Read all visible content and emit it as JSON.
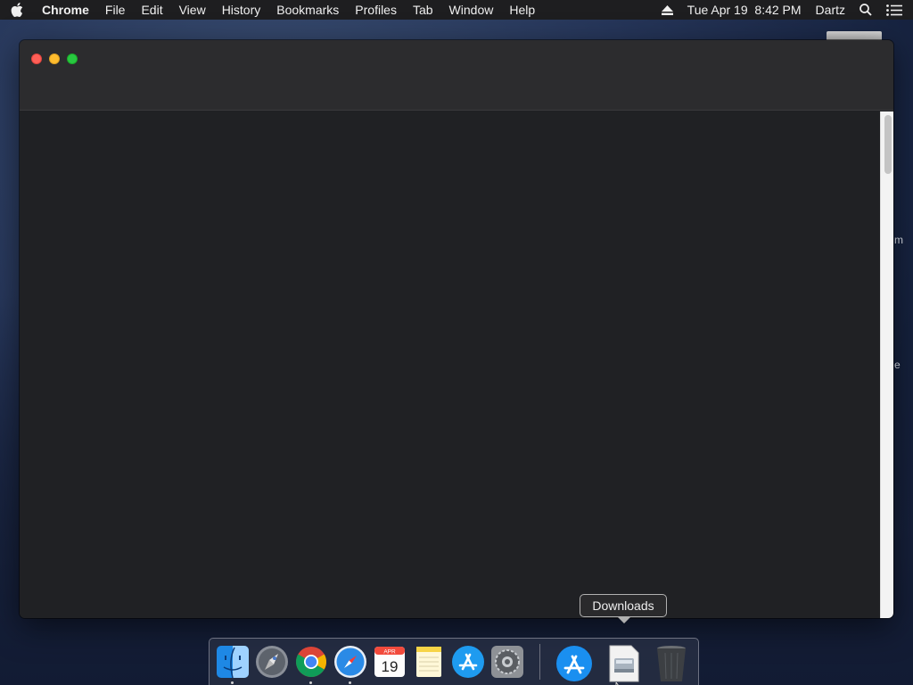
{
  "menubar": {
    "app_name": "Chrome",
    "items": [
      "File",
      "Edit",
      "View",
      "History",
      "Bookmarks",
      "Profiles",
      "Tab",
      "Window",
      "Help"
    ],
    "clock": "Tue Apr 19  8:42 PM",
    "user": "Dartz",
    "icons": [
      "apple-icon",
      "eject-icon",
      "spotlight-search-icon",
      "notification-center-icon"
    ]
  },
  "desktop": {
    "partial_labels": [
      "m",
      "e"
    ]
  },
  "window": {
    "title": "",
    "controls": [
      "close",
      "minimize",
      "maximize"
    ]
  },
  "tooltip": {
    "text": "Downloads"
  },
  "dock": {
    "items": [
      {
        "name": "Finder",
        "icon": "finder-icon",
        "running": true
      },
      {
        "name": "Launchpad",
        "icon": "launchpad-icon",
        "running": false
      },
      {
        "name": "Google Chrome",
        "icon": "chrome-icon",
        "running": true
      },
      {
        "name": "Safari",
        "icon": "safari-icon",
        "running": true
      },
      {
        "name": "Calendar",
        "icon": "calendar-icon",
        "running": false,
        "month": "APR",
        "day": "19"
      },
      {
        "name": "Notes",
        "icon": "notes-icon",
        "running": false
      },
      {
        "name": "App Store",
        "icon": "app-store-icon",
        "running": false
      },
      {
        "name": "System Preferences",
        "icon": "system-preferences-icon",
        "running": false
      },
      {
        "name": "Applications",
        "icon": "applications-folder-icon",
        "running": false
      },
      {
        "name": "Downloads",
        "icon": "downloads-stack-icon",
        "running": false
      },
      {
        "name": "Trash",
        "icon": "trash-icon",
        "running": false
      }
    ]
  },
  "colors": {
    "menubar_bg": "#1e1e20",
    "window_bg": "#202124",
    "titlebar_bg": "#2c2c2e",
    "close": "#fe5f57",
    "minimize": "#febc2e",
    "maximize": "#28c840"
  }
}
